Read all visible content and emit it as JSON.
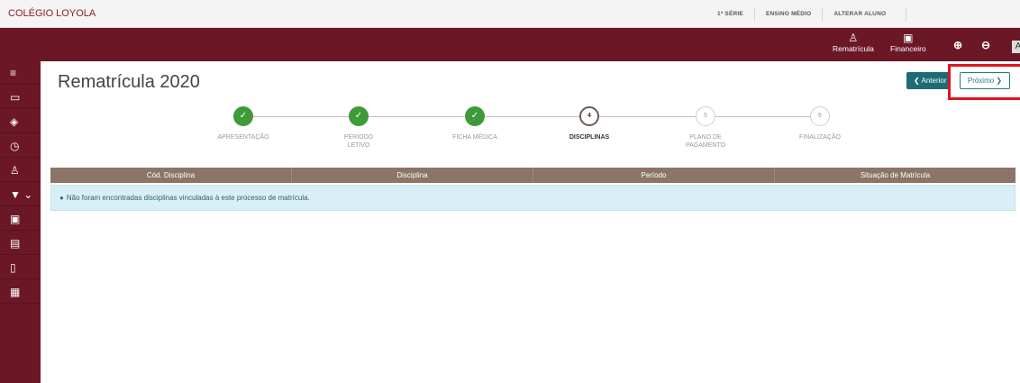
{
  "topbar": {
    "school": "COLÉGIO LOYOLA",
    "links": [
      "1ª SÉRIE",
      "ENSINO MÉDIO",
      "ALTERAR ALUNO"
    ]
  },
  "navbar": {
    "rematricula": "Rematrícula",
    "financeiro": "Financeiro",
    "font_label": "A"
  },
  "page": {
    "title": "Rematrícula 2020",
    "prev_label": "Anterior",
    "next_label": "Próximo"
  },
  "steps": [
    {
      "number": "✓",
      "label": "APRESENTAÇÃO",
      "state": "done"
    },
    {
      "number": "✓",
      "label": "PERÍODO LETIVO",
      "state": "done"
    },
    {
      "number": "✓",
      "label": "FICHA MÉDICA",
      "state": "done"
    },
    {
      "number": "4",
      "label": "DISCIPLINAS",
      "state": "active"
    },
    {
      "number": "5",
      "label": "PLANO DE PAGAMENTO",
      "state": "pending"
    },
    {
      "number": "6",
      "label": "FINALIZAÇÃO",
      "state": "pending"
    }
  ],
  "table": {
    "columns": [
      "Cód. Disciplina",
      "Disciplina",
      "Período",
      "Situação de Matrícula"
    ],
    "empty_message": "Não foram encontradas disciplinas vinculadas à este processo de matrícula."
  },
  "colors": {
    "brand": "#6b1726",
    "done": "#3f9a3a",
    "table_header": "#8c7566",
    "info_bg": "#d9eef5",
    "highlight": "#e0141e"
  }
}
